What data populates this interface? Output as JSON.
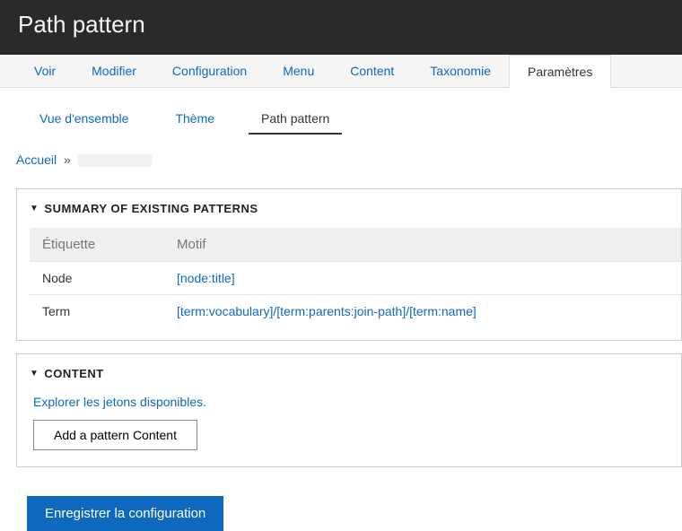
{
  "header": {
    "title": "Path pattern"
  },
  "primary_tabs": [
    {
      "label": "Voir",
      "active": false
    },
    {
      "label": "Modifier",
      "active": false
    },
    {
      "label": "Configuration",
      "active": false
    },
    {
      "label": "Menu",
      "active": false
    },
    {
      "label": "Content",
      "active": false
    },
    {
      "label": "Taxonomie",
      "active": false
    },
    {
      "label": "Paramètres",
      "active": true
    }
  ],
  "secondary_tabs": [
    {
      "label": "Vue d'ensemble",
      "active": false
    },
    {
      "label": "Thème",
      "active": false
    },
    {
      "label": "Path pattern",
      "active": true
    }
  ],
  "breadcrumb": {
    "home": "Accueil",
    "sep": "»"
  },
  "summary": {
    "title": "SUMMARY OF EXISTING PATTERNS",
    "headers": {
      "etiquette": "Étiquette",
      "motif": "Motif"
    },
    "rows": [
      {
        "etiquette": "Node",
        "motif": "[node:title]"
      },
      {
        "etiquette": "Term",
        "motif": "[term:vocabulary]/[term:parents:join-path]/[term:name]"
      }
    ]
  },
  "content": {
    "title": "CONTENT",
    "tokens_link": "Explorer les jetons disponibles.",
    "add_button": "Add a pattern Content"
  },
  "actions": {
    "save": "Enregistrer la configuration"
  }
}
